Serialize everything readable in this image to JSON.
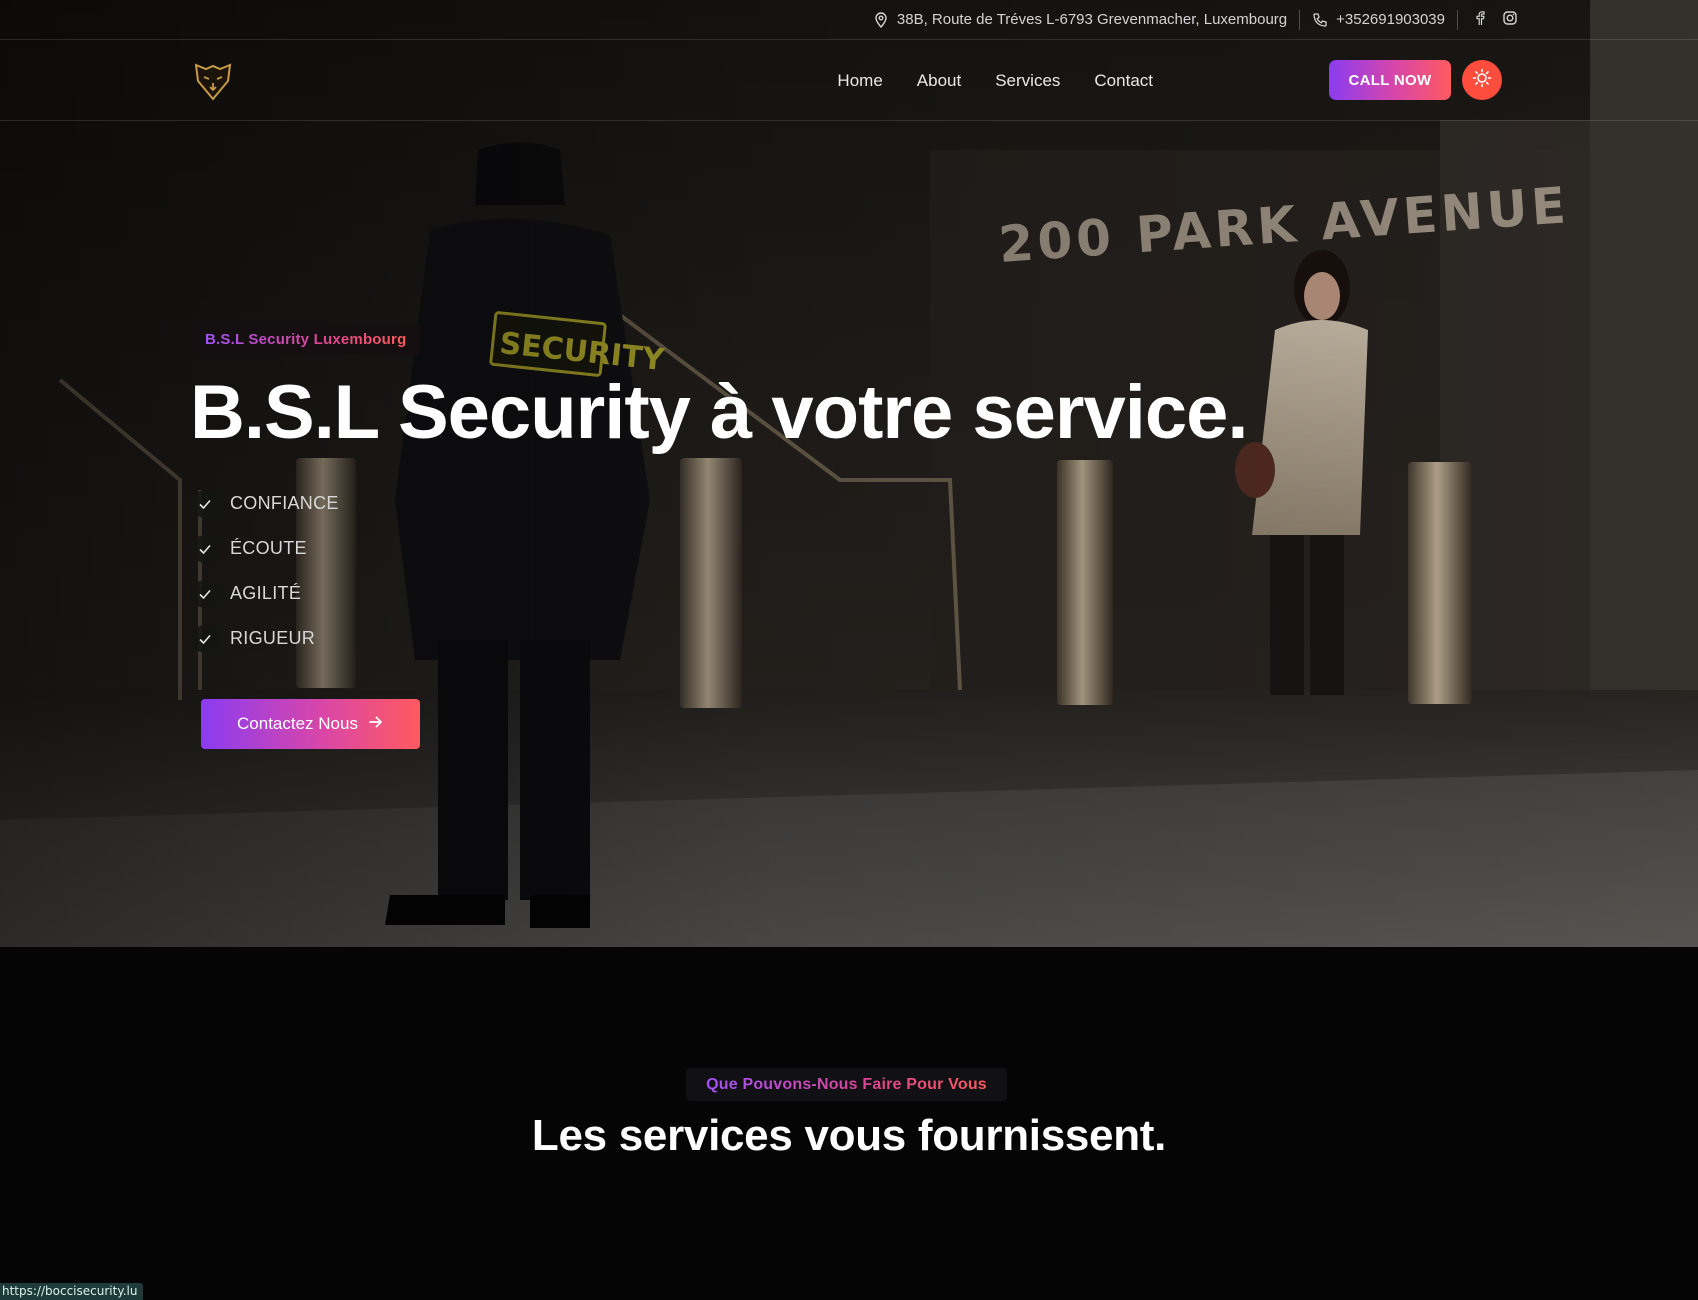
{
  "topbar": {
    "address": "38B, Route de Tréves L-6793 Grevenmacher, Luxembourg",
    "phone": "+352691903039",
    "social": [
      "facebook-icon",
      "instagram-icon"
    ]
  },
  "nav": {
    "items": [
      {
        "label": "Home"
      },
      {
        "label": "About"
      },
      {
        "label": "Services"
      },
      {
        "label": "Contact"
      }
    ],
    "call_label": "CALL NOW",
    "theme_icon": "sun-icon"
  },
  "hero": {
    "eyebrow": "B.S.L Security Luxembourg",
    "title": "B.S.L Security à votre service.",
    "features": [
      "CONFIANCE",
      "ÉCOUTE",
      "AGILITÉ",
      "RIGUEUR"
    ],
    "cta_label": "Contactez Nous",
    "background": {
      "sign_text": "200 PARK AVENUE",
      "badge_text": "SECURITY"
    }
  },
  "services": {
    "eyebrow": "Que Pouvons-Nous Faire Pour Vous",
    "title": "Les services vous fournissent."
  },
  "status_bar": {
    "url": "https://boccisecurity.lu"
  },
  "colors": {
    "gradient_start": "#8a3cf2",
    "gradient_mid": "#d946a8",
    "gradient_end": "#ff5a5f",
    "theme_button": "#ff4d3d",
    "page_bg": "#050505"
  }
}
